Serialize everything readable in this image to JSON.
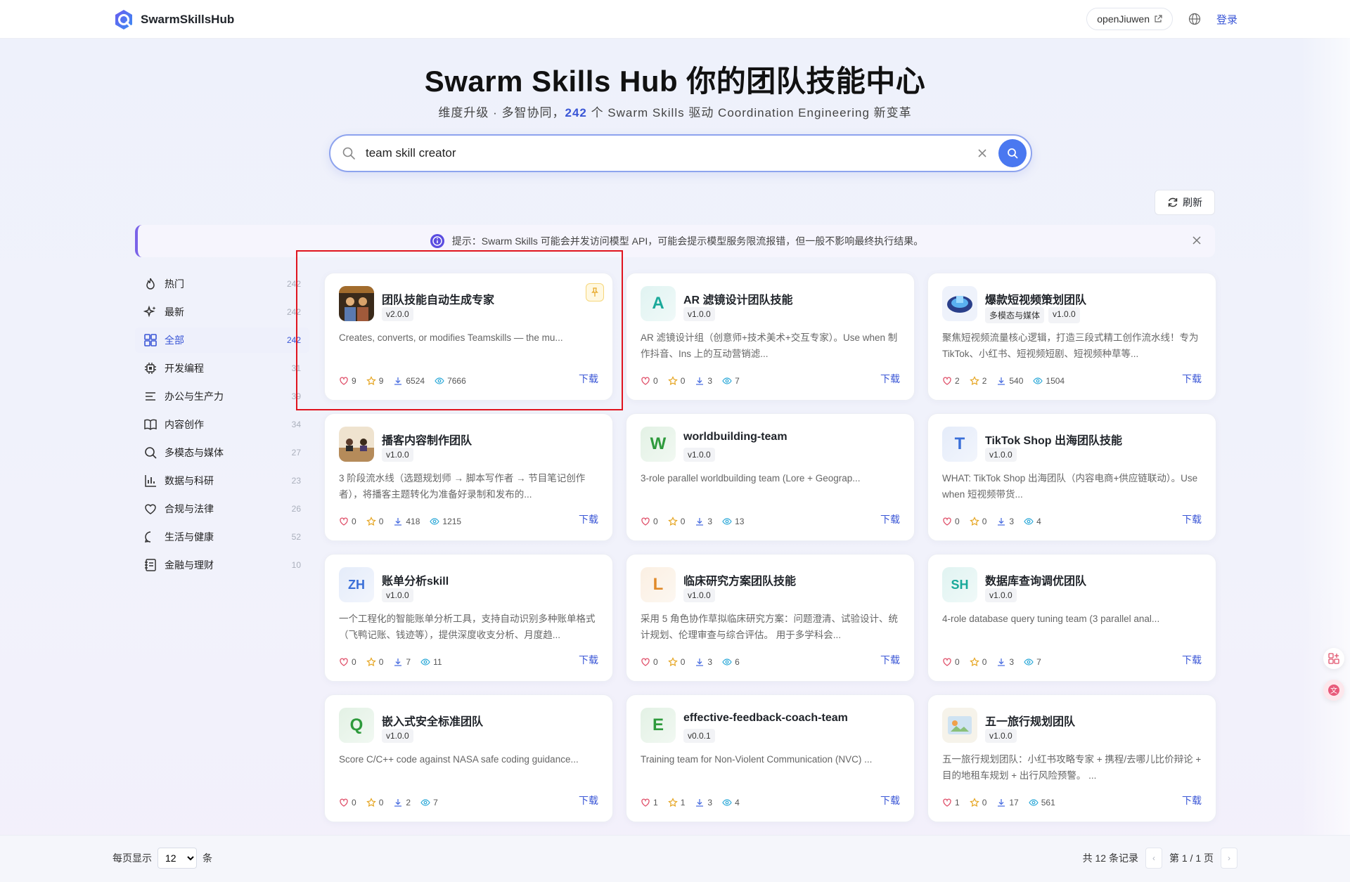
{
  "header": {
    "logo_text": "SwarmSkillsHub",
    "openjiuwen_label": "openJiuwen",
    "login_label": "登录"
  },
  "hero": {
    "title": "Swarm Skills Hub 你的团队技能中心",
    "subtitle_prefix": "维度升级 · 多智协同，",
    "skill_count": "242",
    "subtitle_suffix": " 个 Swarm Skills 驱动 Coordination Engineering 新变革"
  },
  "search": {
    "value": "team skill creator"
  },
  "refresh_label": "刷新",
  "notice": {
    "text": "提示：Swarm Skills 可能会并发访问模型 API，可能会提示模型服务限流报错，但一般不影响最终执行结果。"
  },
  "categories": [
    {
      "label": "热门",
      "count": "242",
      "icon": "flame-icon",
      "active": false
    },
    {
      "label": "最新",
      "count": "242",
      "icon": "sparkle-icon",
      "active": false
    },
    {
      "label": "全部",
      "count": "242",
      "icon": "grid-icon",
      "active": true
    },
    {
      "label": "开发编程",
      "count": "31",
      "icon": "chip-icon",
      "active": false
    },
    {
      "label": "办公与生产力",
      "count": "39",
      "icon": "lines-icon",
      "active": false
    },
    {
      "label": "内容创作",
      "count": "34",
      "icon": "book-icon",
      "active": false
    },
    {
      "label": "多模态与媒体",
      "count": "27",
      "icon": "search-icon",
      "active": false
    },
    {
      "label": "数据与科研",
      "count": "23",
      "icon": "bar-chart-icon",
      "active": false
    },
    {
      "label": "合规与法律",
      "count": "26",
      "icon": "heart-icon",
      "active": false
    },
    {
      "label": "生活与健康",
      "count": "52",
      "icon": "chat-bubble-icon",
      "active": false
    },
    {
      "label": "金融与理财",
      "count": "10",
      "icon": "ledger-icon",
      "active": false
    }
  ],
  "cards": [
    {
      "title": "团队技能自动生成专家",
      "tags": [
        "v2.0.0"
      ],
      "desc": "Creates, converts, or modifies Teamskills — the mu...",
      "likes": "9",
      "stars": "9",
      "downloads": "6524",
      "views": "7666",
      "avatar": "img",
      "avatar_text": "",
      "avatar_color": "#6a4a2a",
      "pinned": true
    },
    {
      "title": "AR 滤镜设计团队技能",
      "tags": [
        "v1.0.0"
      ],
      "desc": "AR 滤镜设计组（创意师+技术美术+交互专家）。Use when 制作抖音、Ins 上的互动营销滤...",
      "likes": "0",
      "stars": "0",
      "downloads": "3",
      "views": "7",
      "avatar": "letter",
      "avatar_text": "A",
      "avatar_color": "#1aa99a",
      "pinned": false
    },
    {
      "title": "爆款短视频策划团队",
      "tags": [
        "多模态与媒体",
        "v1.0.0"
      ],
      "desc": "聚焦短视频流量核心逻辑，打造三段式精工创作流水线！专为TikTok、小红书、短视频短剧、短视频种草等...",
      "likes": "2",
      "stars": "2",
      "downloads": "540",
      "views": "1504",
      "avatar": "img",
      "avatar_text": "",
      "avatar_color": "#2a3f8a",
      "pinned": false
    },
    {
      "title": "播客内容制作团队",
      "tags": [
        "v1.0.0"
      ],
      "desc": "3 阶段流水线（选题规划师 → 脚本写作者 → 节目笔记创作者），将播客主题转化为准备好录制和发布的...",
      "likes": "0",
      "stars": "0",
      "downloads": "418",
      "views": "1215",
      "avatar": "img",
      "avatar_text": "",
      "avatar_color": "#b58b5a",
      "pinned": false
    },
    {
      "title": "worldbuilding-team",
      "tags": [
        "v1.0.0"
      ],
      "desc": "3-role parallel worldbuilding team (Lore + Geograp...",
      "likes": "0",
      "stars": "0",
      "downloads": "3",
      "views": "13",
      "avatar": "letter",
      "avatar_text": "W",
      "avatar_color": "#2e9a3c",
      "pinned": false
    },
    {
      "title": "TikTok Shop 出海团队技能",
      "tags": [
        "v1.0.0"
      ],
      "desc": "WHAT: TikTok Shop 出海团队（内容电商+供应链联动）。Use when 短视频带货...",
      "likes": "0",
      "stars": "0",
      "downloads": "3",
      "views": "4",
      "avatar": "letter",
      "avatar_text": "T",
      "avatar_color": "#3a6fd8",
      "pinned": false
    },
    {
      "title": "账单分析skill",
      "tags": [
        "v1.0.0"
      ],
      "desc": "一个工程化的智能账单分析工具，支持自动识别多种账单格式（飞鸭记账、钱迹等），提供深度收支分析、月度趋...",
      "likes": "0",
      "stars": "0",
      "downloads": "7",
      "views": "11",
      "avatar": "letter",
      "avatar_text": "ZH",
      "avatar_color": "#3a6fd8",
      "pinned": false
    },
    {
      "title": "临床研究方案团队技能",
      "tags": [
        "v1.0.0"
      ],
      "desc": "采用 5 角色协作草拟临床研究方案：问题澄清、试验设计、统计规划、伦理审查与综合评估。 用于多学科会...",
      "likes": "0",
      "stars": "0",
      "downloads": "3",
      "views": "6",
      "avatar": "letter",
      "avatar_text": "L",
      "avatar_color": "#e08a2a",
      "pinned": false
    },
    {
      "title": "数据库查询调优团队",
      "tags": [
        "v1.0.0"
      ],
      "desc": "4-role database query tuning team (3 parallel anal...",
      "likes": "0",
      "stars": "0",
      "downloads": "3",
      "views": "7",
      "avatar": "letter",
      "avatar_text": "SH",
      "avatar_color": "#1aa99a",
      "pinned": false
    },
    {
      "title": "嵌入式安全标准团队",
      "tags": [
        "v1.0.0"
      ],
      "desc": "Score C/C++ code against NASA safe coding guidance...",
      "likes": "0",
      "stars": "0",
      "downloads": "2",
      "views": "7",
      "avatar": "letter",
      "avatar_text": "Q",
      "avatar_color": "#2e9a3c",
      "pinned": false
    },
    {
      "title": "effective-feedback-coach-team",
      "tags": [
        "v0.0.1"
      ],
      "desc": "Training team for Non-Violent Communication (NVC) ...",
      "likes": "1",
      "stars": "1",
      "downloads": "3",
      "views": "4",
      "avatar": "letter",
      "avatar_text": "E",
      "avatar_color": "#2e9a3c",
      "pinned": false
    },
    {
      "title": "五一旅行规划团队",
      "tags": [
        "v1.0.0"
      ],
      "desc": "五一旅行规划团队：小红书攻略专家 + 携程/去哪儿比价辩论 + 目的地租车规划 + 出行风险预警。 ...",
      "likes": "1",
      "stars": "0",
      "downloads": "17",
      "views": "561",
      "avatar": "img",
      "avatar_text": "",
      "avatar_color": "#cfe3f2",
      "pinned": false
    }
  ],
  "card_download_label": "下载",
  "pagination": {
    "per_page_label": "每页显示",
    "per_page_value": "12",
    "per_page_unit": "条",
    "total_label": "共 12 条记录",
    "page_label": "第 1 / 1 页"
  },
  "colors": {
    "accent": "#3a56d6",
    "search_button": "#4a78f0",
    "highlight_box": "#e0141e"
  }
}
